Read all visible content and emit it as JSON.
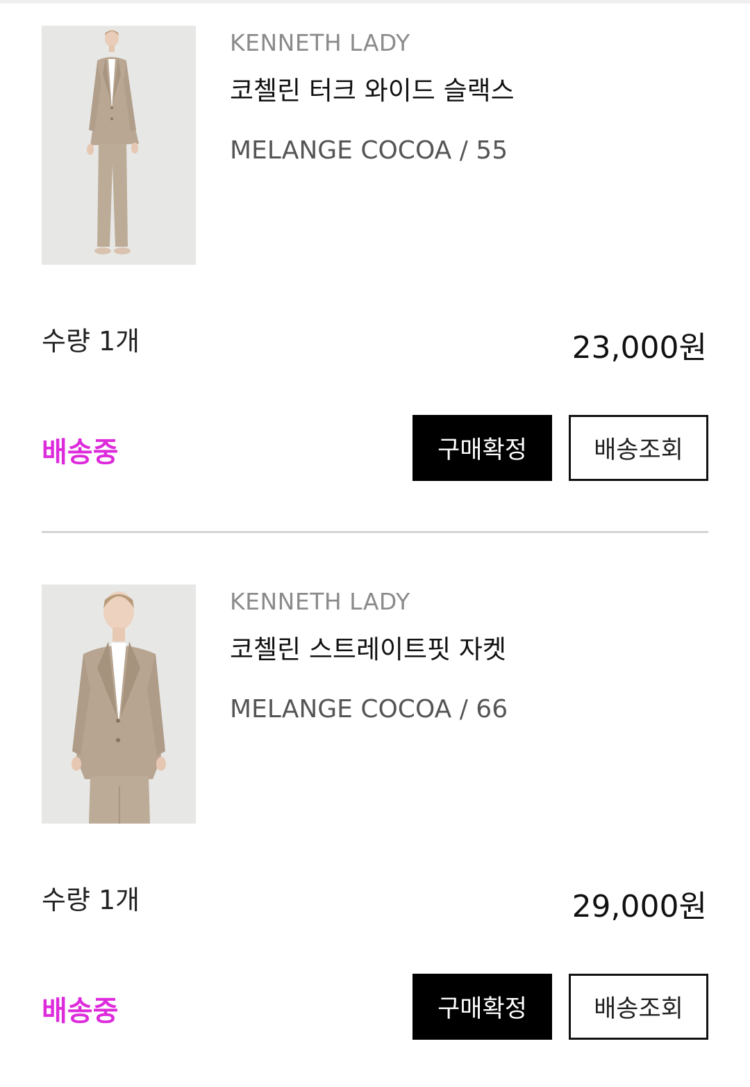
{
  "items": [
    {
      "brand": "KENNETH LADY",
      "name": "코첼린 터크 와이드 슬랙스",
      "option": "MELANGE COCOA / 55",
      "quantity": "수량 1개",
      "price": "23,000원",
      "status": "배송중",
      "confirm_label": "구매확정",
      "track_label": "배송조회"
    },
    {
      "brand": "KENNETH LADY",
      "name": "코첼린 스트레이트핏 자켓",
      "option": "MELANGE COCOA / 66",
      "quantity": "수량 1개",
      "price": "29,000원",
      "status": "배송중",
      "confirm_label": "구매확정",
      "track_label": "배송조회"
    }
  ],
  "colors": {
    "status": "#dd2bdc",
    "product_beige": "#b9a895",
    "button_dark": "#000000"
  }
}
